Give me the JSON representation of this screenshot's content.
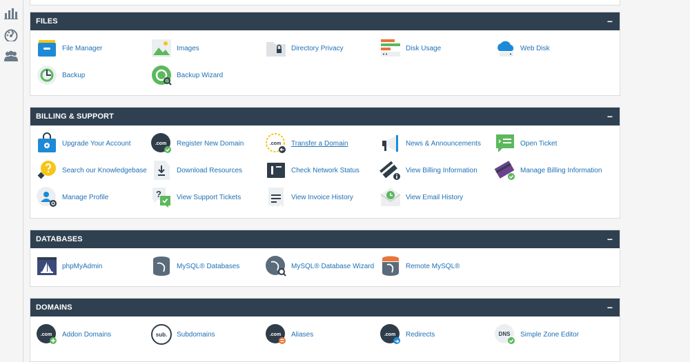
{
  "sidebar": {
    "icons": [
      "bar-chart-icon",
      "dashboard-gauge-icon",
      "users-group-icon"
    ]
  },
  "sections": [
    {
      "title": "FILES",
      "collapse": "−",
      "items": [
        {
          "label": "File Manager",
          "icon": "file-manager-icon"
        },
        {
          "label": "Images",
          "icon": "images-icon"
        },
        {
          "label": "Directory Privacy",
          "icon": "directory-privacy-icon"
        },
        {
          "label": "Disk Usage",
          "icon": "disk-usage-icon"
        },
        {
          "label": "Web Disk",
          "icon": "web-disk-icon"
        },
        {
          "label": "Backup",
          "icon": "backup-icon"
        },
        {
          "label": "Backup Wizard",
          "icon": "backup-wizard-icon"
        }
      ]
    },
    {
      "title": "BILLING & SUPPORT",
      "collapse": "−",
      "items": [
        {
          "label": "Upgrade Your Account",
          "icon": "upgrade-account-icon"
        },
        {
          "label": "Register New Domain",
          "icon": "register-domain-icon"
        },
        {
          "label": "Transfer a Domain",
          "icon": "transfer-domain-icon"
        },
        {
          "label": "News & Announcements",
          "icon": "megaphone-icon"
        },
        {
          "label": "Open Ticket",
          "icon": "open-ticket-icon"
        },
        {
          "label": "Search our Knowledgebase",
          "icon": "lightbulb-icon"
        },
        {
          "label": "Download Resources",
          "icon": "download-icon"
        },
        {
          "label": "Check Network Status",
          "icon": "network-status-icon"
        },
        {
          "label": "View Billing Information",
          "icon": "billing-info-icon"
        },
        {
          "label": "Manage Billing Information",
          "icon": "credit-card-icon"
        },
        {
          "label": "Manage Profile",
          "icon": "profile-icon"
        },
        {
          "label": "View Support Tickets",
          "icon": "support-tickets-icon"
        },
        {
          "label": "View Invoice History",
          "icon": "invoice-icon"
        },
        {
          "label": "View Email History",
          "icon": "email-history-icon"
        }
      ]
    },
    {
      "title": "DATABASES",
      "collapse": "−",
      "items": [
        {
          "label": "phpMyAdmin",
          "icon": "phpmyadmin-icon"
        },
        {
          "label": "MySQL® Databases",
          "icon": "mysql-database-icon"
        },
        {
          "label": "MySQL® Database Wizard",
          "icon": "mysql-wizard-icon"
        },
        {
          "label": "Remote MySQL®",
          "icon": "remote-mysql-icon"
        }
      ]
    },
    {
      "title": "DOMAINS",
      "collapse": "−",
      "items": [
        {
          "label": "Addon Domains",
          "icon": "addon-domains-icon",
          "badge": ".com"
        },
        {
          "label": "Subdomains",
          "icon": "subdomains-icon",
          "badge": "sub."
        },
        {
          "label": "Aliases",
          "icon": "aliases-icon",
          "badge": ".com"
        },
        {
          "label": "Redirects",
          "icon": "redirects-icon",
          "badge": ".com"
        },
        {
          "label": "Simple Zone Editor",
          "icon": "zone-editor-icon",
          "badge": "DNS"
        }
      ]
    }
  ],
  "colors": {
    "header": "#2f4050",
    "link": "#1f6fb4",
    "green": "#5cb85c",
    "blue": "#1e8ad6",
    "dark": "#2f3d4a",
    "orange": "#e8743b",
    "purple": "#6f3f8f",
    "yellow": "#f5c518"
  }
}
